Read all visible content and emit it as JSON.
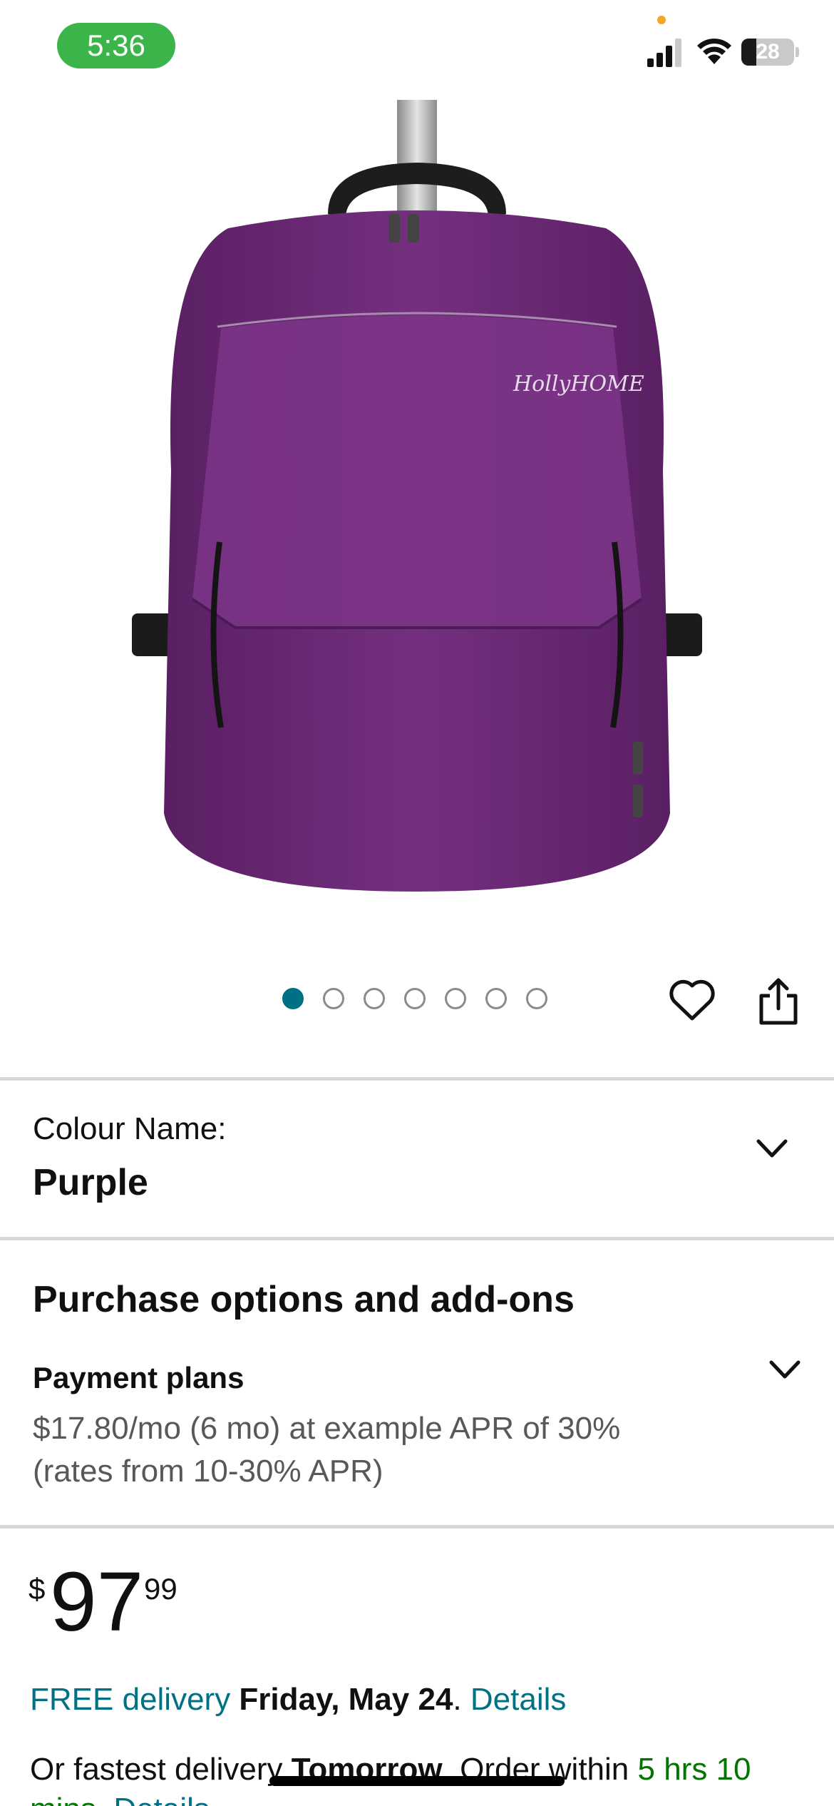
{
  "status_bar": {
    "time": "5:36",
    "battery": "28",
    "battery_level": 0.28,
    "icons": [
      "signal-icon",
      "wifi-icon",
      "battery-icon"
    ]
  },
  "product_image": {
    "brand_mark": "HollyHOME",
    "color": "#6e2d78"
  },
  "carousel": {
    "count": 7,
    "active_index": 0,
    "active_color": "#007185"
  },
  "actions": {
    "icons": [
      "heart-icon",
      "share-icon"
    ]
  },
  "colour": {
    "label": "Colour Name:",
    "value": "Purple"
  },
  "purchase_options": {
    "title": "Purchase options and add-ons",
    "payment_plans": {
      "title": "Payment plans",
      "line1": "$17.80/mo (6 mo) at example APR of 30%",
      "line2": "(rates from 10-30% APR)"
    }
  },
  "price": {
    "symbol": "$",
    "whole": "97",
    "fraction": "99"
  },
  "delivery": {
    "free": "FREE delivery",
    "date": "Friday, May 24",
    "period": ".",
    "details": "Details"
  },
  "fastest": {
    "prefix": "Or fastest delivery",
    "day": "Tomorrow",
    "mid": ". Order within",
    "countdown": "5 hrs 10",
    "line2_start": "mins.",
    "line2_details": "Details"
  },
  "colors": {
    "teal_link": "#007185",
    "green_text": "#007600",
    "divider": "#d5d9d9",
    "status_pill": "#3bb54a"
  }
}
